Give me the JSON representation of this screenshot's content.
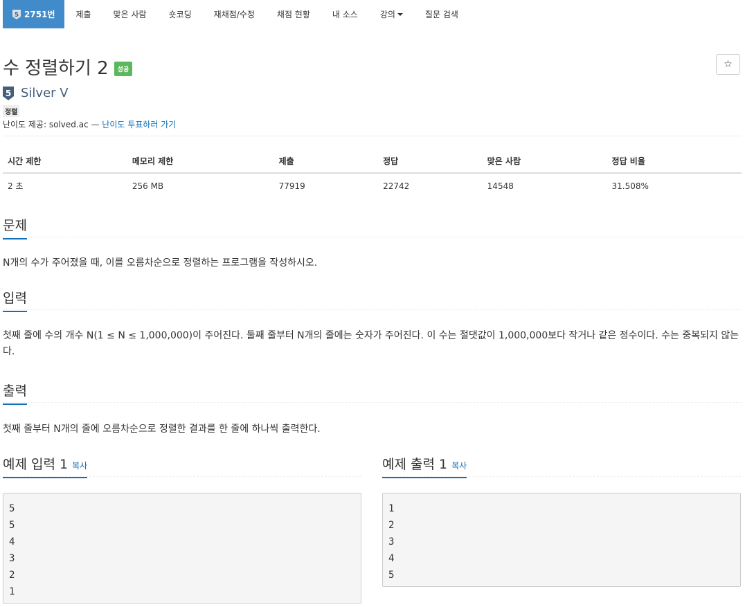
{
  "nav": {
    "problem_number": "2751번",
    "tabs": [
      "제출",
      "맞은 사람",
      "숏코딩",
      "재채점/수정",
      "채점 현황",
      "내 소스",
      "강의",
      "질문 검색"
    ],
    "tier_badge_text": "5"
  },
  "problem": {
    "title": "수 정렬하기 2",
    "status_label": "성공",
    "star_icon": "☆",
    "tier_number": "5",
    "tier_name": "Silver V",
    "tag": "정렬",
    "difficulty_prefix": "난이도 제공: solved.ac — ",
    "difficulty_link": "난이도 투표하러 가기"
  },
  "info_table": {
    "headers": [
      "시간 제한",
      "메모리 제한",
      "제출",
      "정답",
      "맞은 사람",
      "정답 비율"
    ],
    "values": [
      "2 초",
      "256 MB",
      "77919",
      "22742",
      "14548",
      "31.508%"
    ]
  },
  "sections": {
    "problem_title": "문제",
    "problem_text": "N개의 수가 주어졌을 때, 이를 오름차순으로 정렬하는 프로그램을 작성하시오.",
    "input_title": "입력",
    "input_text": "첫째 줄에 수의 개수 N(1 ≤ N ≤ 1,000,000)이 주어진다. 둘째 줄부터 N개의 줄에는 숫자가 주어진다. 이 수는 절댓값이 1,000,000보다 작거나 같은 정수이다. 수는 중복되지 않는다.",
    "output_title": "출력",
    "output_text": "첫째 줄부터 N개의 줄에 오름차순으로 정렬한 결과를 한 줄에 하나씩 출력한다."
  },
  "samples": {
    "input_title": "예제 입력 1",
    "output_title": "예제 출력 1",
    "copy_label": "복사",
    "input_data": "5\n5\n4\n3\n2\n1",
    "output_data": "1\n2\n3\n4\n5"
  },
  "colors": {
    "nav_active": "#428bca",
    "success": "#5cb85c",
    "link": "#0f70b7",
    "silver_tier": "#435f7a"
  }
}
